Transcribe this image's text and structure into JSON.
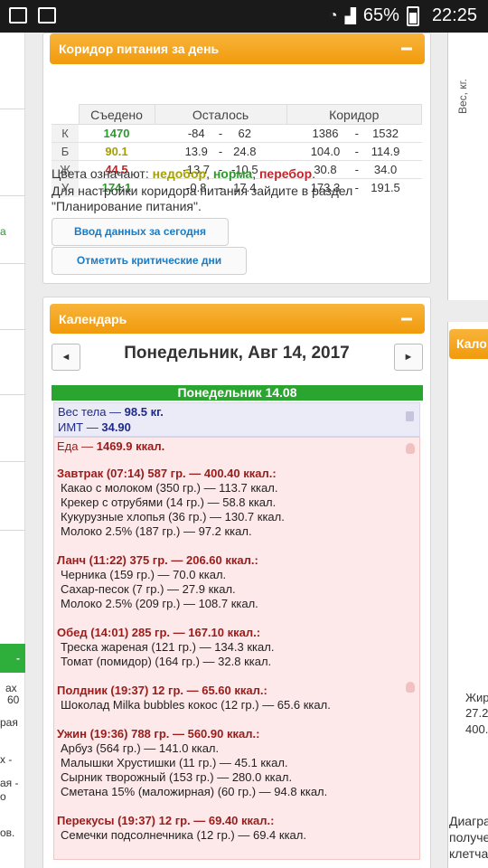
{
  "statusbar": {
    "battery": "65%",
    "time": "22:25"
  },
  "corridor": {
    "title": "Коридор питания за день",
    "headers": [
      "Съедено",
      "Осталось",
      "Коридор"
    ],
    "rows": [
      {
        "label": "К",
        "eaten": "1470",
        "rem_min": "-84",
        "rem_max": "62",
        "cor_min": "1386",
        "cor_max": "1532",
        "color": "#2c9a2c"
      },
      {
        "label": "Б",
        "eaten": "90.1",
        "rem_min": "13.9",
        "rem_max": "24.8",
        "cor_min": "104.0",
        "cor_max": "114.9",
        "color": "#a6a100"
      },
      {
        "label": "Ж",
        "eaten": "44.5",
        "rem_min": "-13.7",
        "rem_max": "-10.5",
        "cor_min": "30.8",
        "cor_max": "34.0",
        "color": "#c0262c"
      },
      {
        "label": "У",
        "eaten": "174.1",
        "rem_min": "-0.8",
        "rem_max": "17.4",
        "cor_min": "173.3",
        "cor_max": "191.5",
        "color": "#2c9a2c"
      }
    ],
    "legend_prefix": "Цвета означают:",
    "legend_under": "недобор",
    "legend_norm": "норма",
    "legend_over": "перебор",
    "note": "Для настройки коридора питания зайдите в раздел \"Планирование питания\".",
    "btn_input": "Ввод данных за сегодня",
    "btn_critical": "Отметить критические дни"
  },
  "calendar": {
    "title": "Календарь",
    "date": "Понедельник, Авг 14, 2017",
    "prev": "◄",
    "next": "►",
    "day_label": "Понедельник 14.08",
    "weight_label": "Вес тела —",
    "weight_value": "98.5 кг.",
    "bmi_label": "ИМТ —",
    "bmi_value": "34.90",
    "food_label": "Еда —",
    "food_value": "1469.9 ккал.",
    "meals": [
      {
        "title": "Завтрак (07:14) 587 гр. — 400.40 ккал.:",
        "items": [
          "Какао с молоком (350 гр.) — 113.7 ккал.",
          "Крекер с отрубями (14 гр.) — 58.8 ккал.",
          "Кукурузные хлопья (36 гр.) — 130.7 ккал.",
          "Молоко 2.5% (187 гр.) — 97.2 ккал."
        ]
      },
      {
        "title": "Ланч (11:22) 375 гр. — 206.60 ккал.:",
        "items": [
          "Черника (159 гр.) — 70.0 ккал.",
          "Сахар-песок (7 гр.) — 27.9 ккал.",
          "Молоко 2.5% (209 гр.) — 108.7 ккал."
        ]
      },
      {
        "title": "Обед (14:01) 285 гр. — 167.10 ккал.:",
        "items": [
          "Треска жареная (121 гр.) — 134.3 ккал.",
          "Томат (помидор) (164 гр.) — 32.8 ккал."
        ]
      },
      {
        "title": "Полдник (19:37) 12 гр. — 65.60 ккал.:",
        "items": [
          "Шоколад Milka bubbles кокос (12 гр.) — 65.6 ккал."
        ]
      },
      {
        "title": "Ужин (19:36) 788 гр. — 560.90 ккал.:",
        "items": [
          "Арбуз (564 гр.) — 141.0 ккал.",
          "Малышки Хрустишки (11 гр.) — 45.1 ккал.",
          "Сырник творожный (153 гр.) — 280.0 ккал.",
          "Сметана 15% (маложирная) (60 гр.) — 94.8 ккал."
        ]
      },
      {
        "title": "Перекусы (19:37) 12 гр. — 69.40 ккал.:",
        "items": [
          "Семечки подсолнечника (12 гр.) — 69.4 ккал."
        ]
      }
    ]
  },
  "left_fragments": [
    "а",
    "ах",
    "60",
    "рая",
    "х -",
    "ая -",
    "о",
    "ов."
  ],
  "right_fragments": {
    "axis": "Вес, кг.",
    "header": "Кало",
    "line1": "Жир",
    "line2": "27.2",
    "line3": "400.",
    "diagram1": "Диагра",
    "diagram2": "получе",
    "diagram3": "клетча"
  }
}
